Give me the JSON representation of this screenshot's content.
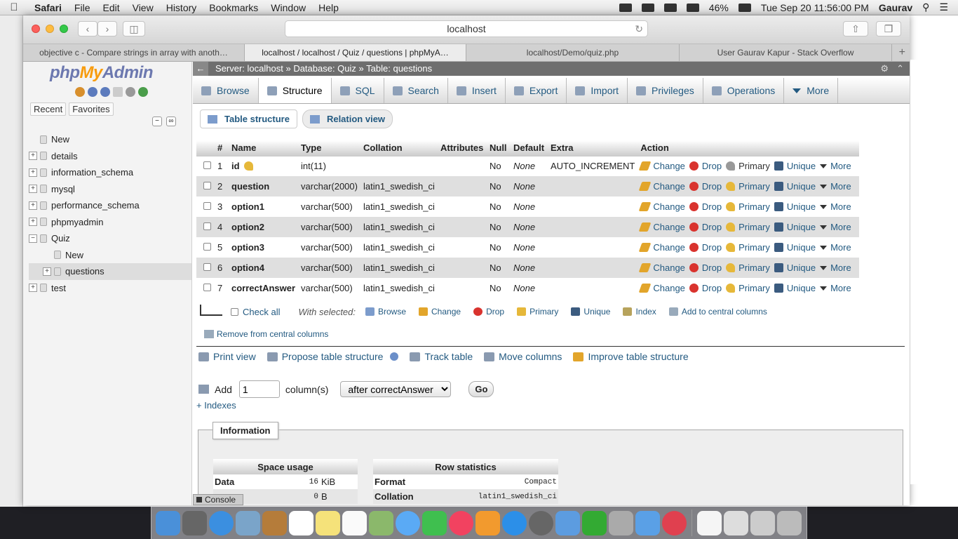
{
  "menubar": {
    "app": "Safari",
    "items": [
      "File",
      "Edit",
      "View",
      "History",
      "Bookmarks",
      "Window",
      "Help"
    ],
    "battery": "46%",
    "datetime": "Tue Sep 20  11:56:00 PM",
    "user": "Gaurav"
  },
  "browser": {
    "url": "localhost",
    "tabs": [
      "objective c - Compare strings in array with anoth…",
      "localhost / localhost / Quiz / questions | phpMyA…",
      "localhost/Demo/quiz.php",
      "User Gaurav Kapur - Stack Overflow"
    ]
  },
  "nav": {
    "logo": {
      "php": "php",
      "my": "My",
      "admin": "Admin"
    },
    "recent": "Recent",
    "favorites": "Favorites",
    "tree": [
      {
        "label": "New",
        "level": 0,
        "exp": ""
      },
      {
        "label": "details",
        "level": 0,
        "exp": "+"
      },
      {
        "label": "information_schema",
        "level": 0,
        "exp": "+"
      },
      {
        "label": "mysql",
        "level": 0,
        "exp": "+"
      },
      {
        "label": "performance_schema",
        "level": 0,
        "exp": "+"
      },
      {
        "label": "phpmyadmin",
        "level": 0,
        "exp": "+"
      },
      {
        "label": "Quiz",
        "level": 0,
        "exp": "−"
      },
      {
        "label": "New",
        "level": 1,
        "exp": ""
      },
      {
        "label": "questions",
        "level": 1,
        "exp": "+"
      },
      {
        "label": "test",
        "level": 0,
        "exp": "+"
      }
    ]
  },
  "breadcrumb": {
    "server": "Server: localhost",
    "database": "Database: Quiz",
    "table": "Table: questions",
    "sep": "»"
  },
  "tabs": [
    "Browse",
    "Structure",
    "SQL",
    "Search",
    "Insert",
    "Export",
    "Import",
    "Privileges",
    "Operations",
    "More"
  ],
  "subtabs": {
    "structure": "Table structure",
    "relation": "Relation view"
  },
  "table": {
    "headers": [
      "#",
      "Name",
      "Type",
      "Collation",
      "Attributes",
      "Null",
      "Default",
      "Extra",
      "Action"
    ],
    "actions": {
      "change": "Change",
      "drop": "Drop",
      "primary": "Primary",
      "unique": "Unique",
      "more": "More"
    },
    "rows": [
      {
        "num": "1",
        "name": "id",
        "type": "int(11)",
        "collation": "",
        "attributes": "",
        "null": "No",
        "default": "None",
        "extra": "AUTO_INCREMENT"
      },
      {
        "num": "2",
        "name": "question",
        "type": "varchar(2000)",
        "collation": "latin1_swedish_ci",
        "attributes": "",
        "null": "No",
        "default": "None",
        "extra": ""
      },
      {
        "num": "3",
        "name": "option1",
        "type": "varchar(500)",
        "collation": "latin1_swedish_ci",
        "attributes": "",
        "null": "No",
        "default": "None",
        "extra": ""
      },
      {
        "num": "4",
        "name": "option2",
        "type": "varchar(500)",
        "collation": "latin1_swedish_ci",
        "attributes": "",
        "null": "No",
        "default": "None",
        "extra": ""
      },
      {
        "num": "5",
        "name": "option3",
        "type": "varchar(500)",
        "collation": "latin1_swedish_ci",
        "attributes": "",
        "null": "No",
        "default": "None",
        "extra": ""
      },
      {
        "num": "6",
        "name": "option4",
        "type": "varchar(500)",
        "collation": "latin1_swedish_ci",
        "attributes": "",
        "null": "No",
        "default": "None",
        "extra": ""
      },
      {
        "num": "7",
        "name": "correctAnswer",
        "type": "varchar(500)",
        "collation": "latin1_swedish_ci",
        "attributes": "",
        "null": "No",
        "default": "None",
        "extra": ""
      }
    ]
  },
  "with_selected": {
    "check_all": "Check all",
    "label": "With selected:",
    "items": [
      "Browse",
      "Change",
      "Drop",
      "Primary",
      "Unique",
      "Index",
      "Add to central columns"
    ],
    "remove_central": "Remove from central columns"
  },
  "options": {
    "print": "Print view",
    "propose": "Propose table structure",
    "track": "Track table",
    "move": "Move columns",
    "improve": "Improve table structure"
  },
  "add_column": {
    "label": "Add",
    "value": "1",
    "suffix": "column(s)",
    "position": "after correctAnswer",
    "go": "Go"
  },
  "indexes": "+ Indexes",
  "information": {
    "legend": "Information",
    "space": {
      "title": "Space usage",
      "rows": [
        {
          "label": "Data",
          "value": "16",
          "unit": "KiB"
        },
        {
          "label": "",
          "value": "0",
          "unit": "B"
        }
      ]
    },
    "rowstats": {
      "title": "Row statistics",
      "rows": [
        {
          "label": "Format",
          "value": "Compact"
        },
        {
          "label": "Collation",
          "value": "latin1_swedish_ci"
        }
      ]
    }
  },
  "console": "Console",
  "colors": {
    "link": "#235a81",
    "accent": "#f89c0e",
    "header": "#6e6e6e"
  }
}
